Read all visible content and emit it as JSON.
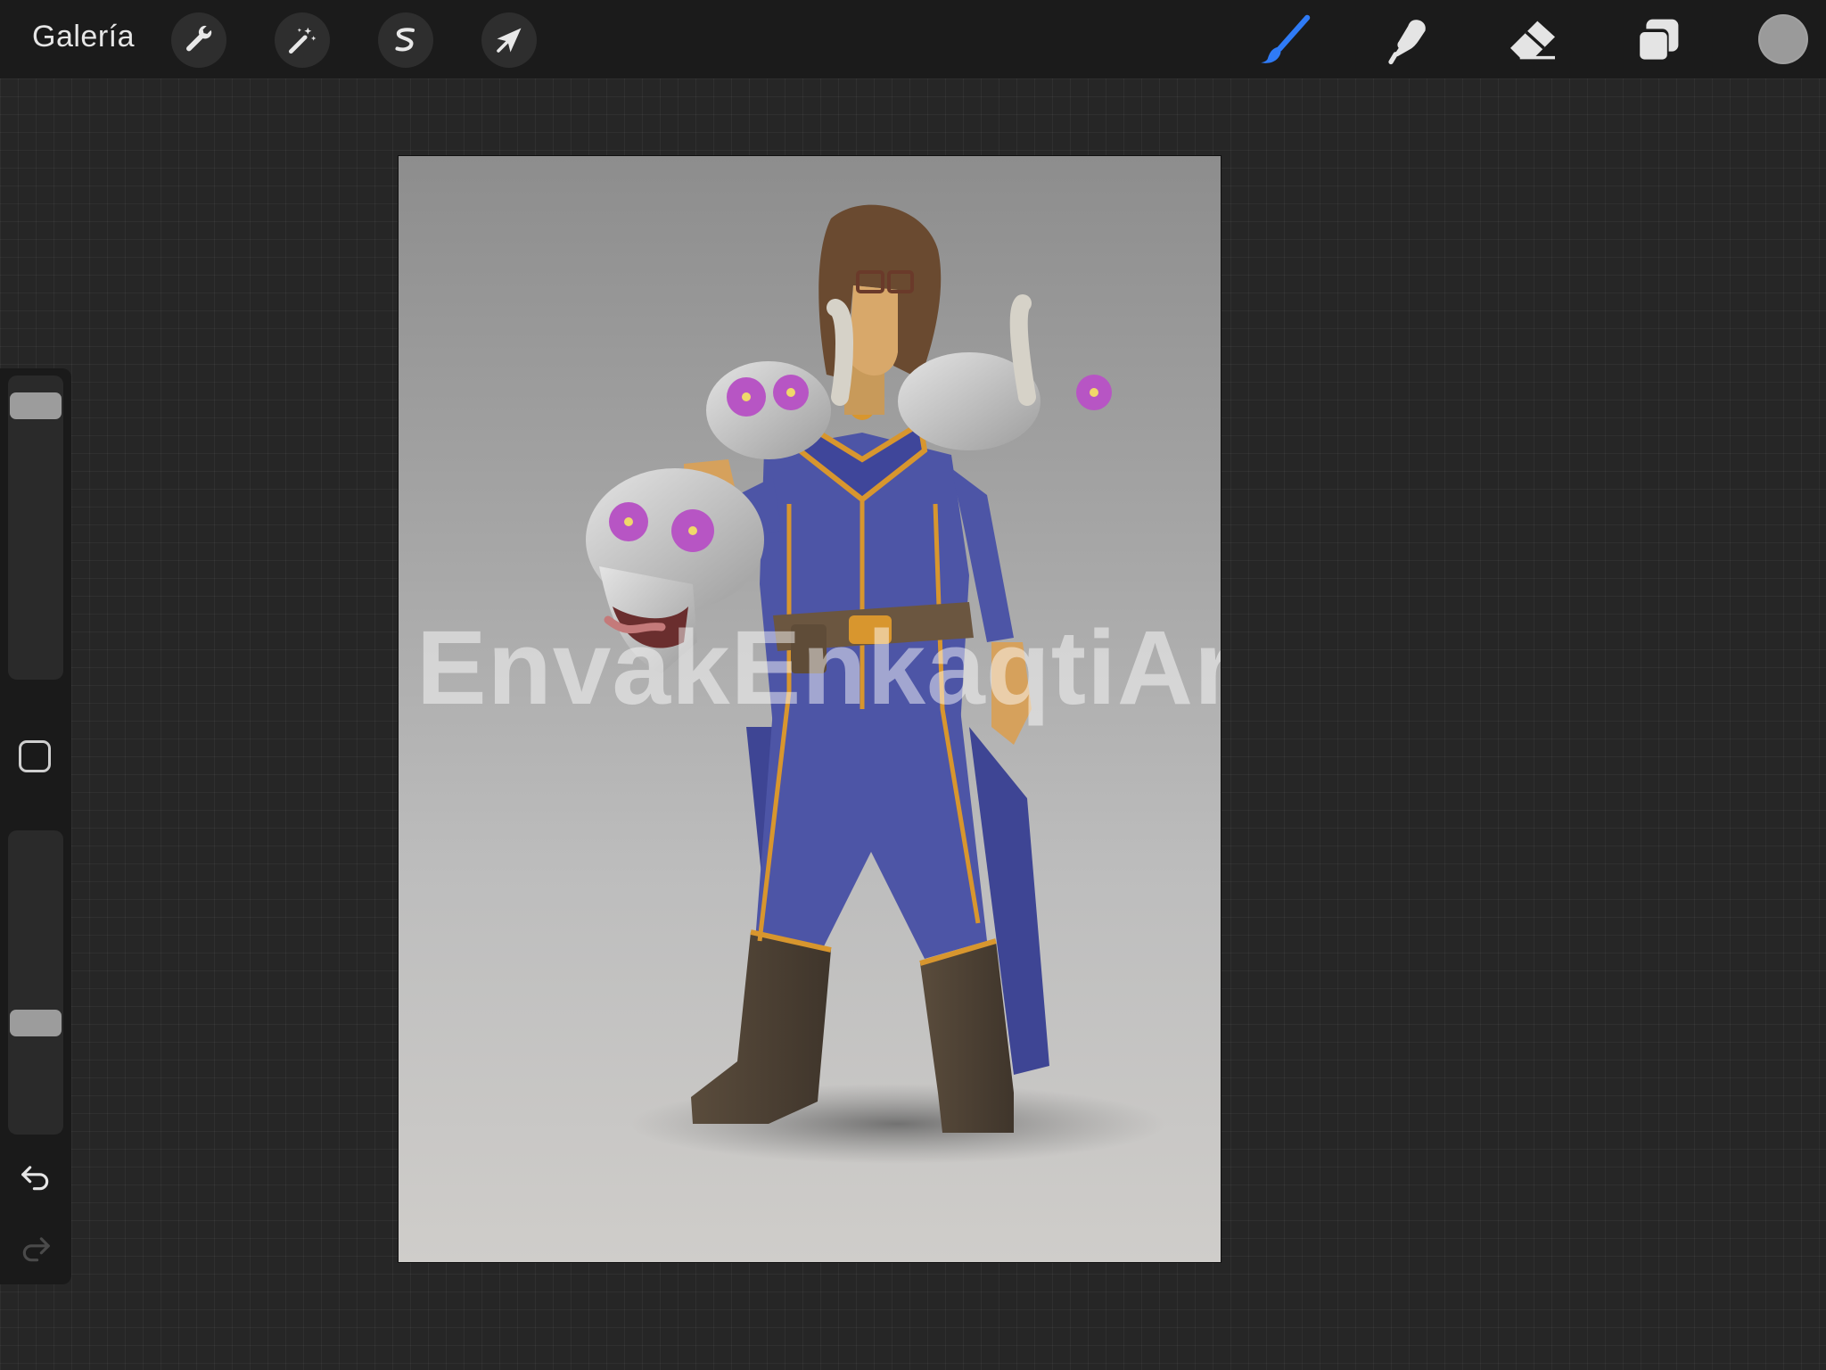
{
  "app": {
    "gallery_label": "Galería"
  },
  "toolbar": {
    "left_tools": [
      {
        "name": "actions",
        "icon": "wrench-icon"
      },
      {
        "name": "adjustments",
        "icon": "magic-wand-icon"
      },
      {
        "name": "selection",
        "icon": "selection-s-icon"
      },
      {
        "name": "transform",
        "icon": "arrow-cursor-icon"
      }
    ],
    "right_tools": [
      {
        "name": "brush",
        "icon": "brush-icon",
        "active": true
      },
      {
        "name": "smudge",
        "icon": "smudge-finger-icon"
      },
      {
        "name": "eraser",
        "icon": "eraser-icon"
      },
      {
        "name": "layers",
        "icon": "layers-icon"
      }
    ],
    "current_color": "#9a9a9a",
    "active_tool_color": "#2f7bf6"
  },
  "sidebar": {
    "brush_size_level": 0.95,
    "opacity_level": 0.35,
    "undo_icon": "undo-arrow-icon",
    "redo_icon": "redo-arrow-icon"
  },
  "canvas": {
    "watermark_text": "EnvakEnkaqtiArt",
    "background_top": "#8d8d8d",
    "background_bottom": "#cfcdca",
    "outfit_color": "#4d55a6",
    "trim_color": "#d8962e"
  }
}
